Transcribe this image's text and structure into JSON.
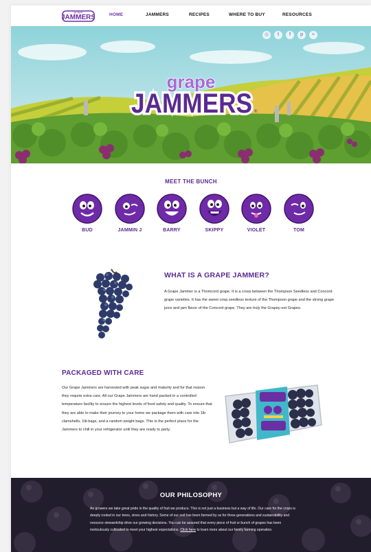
{
  "nav": {
    "logo_text": "Grape JAMMERS",
    "items": [
      {
        "label": "HOME",
        "active": true
      },
      {
        "label": "JAMMERS"
      },
      {
        "label": "RECIPES"
      },
      {
        "label": "WHERE TO BUY"
      },
      {
        "label": "RESOURCES"
      }
    ]
  },
  "hero": {
    "logo_top": "grape",
    "logo_main": "JAMMERS",
    "registered": "®",
    "socials": [
      {
        "icon": "instagram-icon",
        "glyph": "◎"
      },
      {
        "icon": "twitter-icon",
        "glyph": "t"
      },
      {
        "icon": "facebook-icon",
        "glyph": "f"
      },
      {
        "icon": "pinterest-icon",
        "glyph": "p"
      },
      {
        "icon": "rss-icon",
        "glyph": "≈"
      }
    ]
  },
  "bunch": {
    "title": "MEET THE BUNCH",
    "characters": [
      "BUD",
      "JAMMIN J",
      "BARRY",
      "SKIPPY",
      "VIOLET",
      "TOM"
    ]
  },
  "what": {
    "title": "WHAT IS A GRAPE JAMMER?",
    "body": "A Grape Jammer is a Thomcord grape. It is a cross between the Thompson Seedless and Concord grape varieties. It has the sweet crisp seedless texture of the Thompson grape and the strong grape juice and jam flavor of the Concord grape. They are truly the Grapey-est Grapes."
  },
  "packaged": {
    "title": "PACKAGED WITH CARE",
    "body": "Our Grape Jammers are harvested with peak sugar and maturity and for that reason they require extra care. All our Grape Jammers are hand packed in a controlled temperature facility to ensure the highest levels of food safety and quality. To ensure that they are able to make their journey to your home we package them with care into 1lb clamshells, 1lb bags, and a random weight bags. This is the perfect place for the Jammers to chill in your refrigerator until they are ready to party."
  },
  "philosophy": {
    "title": "OUR PHILOSOPHY",
    "body_before": "As growers we take great pride in the quality of fruit we produce. This is not just a business but a way of life. Our care for the crops is deeply rooted in our trees, vines and history. Some of our soil has been farmed by us for three generations and sustainability and resource stewardship drive our growing decisions. You can be assured that every piece of fruit or bunch of grapes has been meticulously cultivated to meet your highest expectations. ",
    "link": "Click here",
    "body_after": " to learn more about our family farming operation."
  },
  "colors": {
    "brand_purple": "#5a2a90",
    "accent_purple": "#6a2fa3",
    "philosophy_bg": "#1e1a28"
  }
}
